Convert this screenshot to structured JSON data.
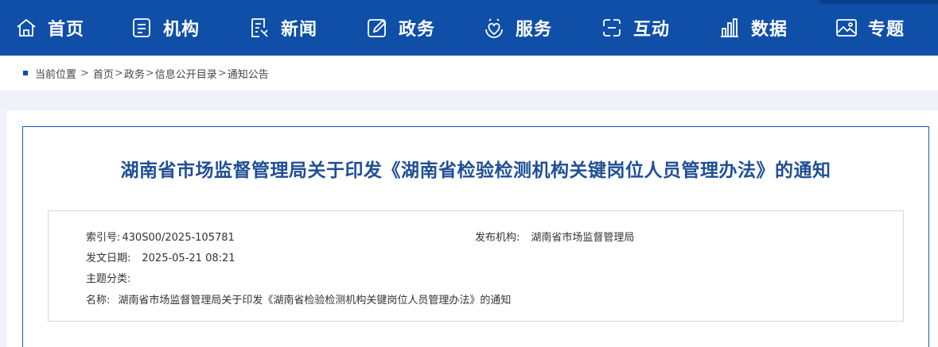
{
  "nav": {
    "items": [
      {
        "label": "首页",
        "icon": "home-icon"
      },
      {
        "label": "机构",
        "icon": "org-doc-icon"
      },
      {
        "label": "新闻",
        "icon": "news-icon"
      },
      {
        "label": "政务",
        "icon": "edit-icon"
      },
      {
        "label": "服务",
        "icon": "service-heart-icon"
      },
      {
        "label": "互动",
        "icon": "interact-icon"
      },
      {
        "label": "数据",
        "icon": "bar-chart-icon"
      },
      {
        "label": "专题",
        "icon": "image-icon"
      }
    ]
  },
  "breadcrumb": {
    "prefix": "当前位置",
    "gt": ">",
    "items": [
      "首页",
      "政务",
      "信息公开目录",
      "通知公告"
    ]
  },
  "article": {
    "title": "湖南省市场监督管理局关于印发《湖南省检验检测机构关键岗位人员管理办法》的通知"
  },
  "info": {
    "index_label": "索引号:",
    "index_value": "430S00/2025-105781",
    "publisher_label": "发布机构:",
    "publisher_value": "湖南省市场监督管理局",
    "date_label": "发文日期:",
    "date_value": "2025-05-21 08:21",
    "topic_label": "主题分类:",
    "topic_value": "",
    "name_label": "名称:",
    "name_value": "湖南省市场监督管理局关于印发《湖南省检验检测机构关键岗位人员管理办法》的通知"
  },
  "colors": {
    "nav_bg": "#0f4fa8",
    "title": "#1f4f95",
    "page_bg": "#eff2f8"
  }
}
